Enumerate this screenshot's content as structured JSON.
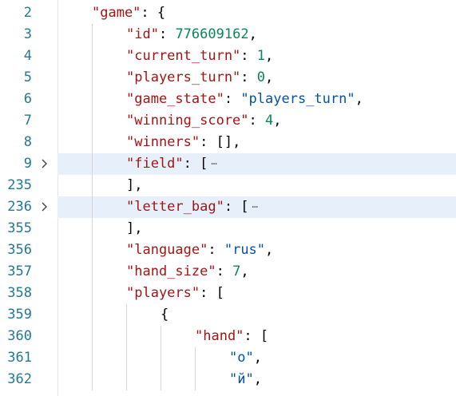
{
  "editor": {
    "lines": [
      {
        "num": "2",
        "indent": 0,
        "tokens": [
          {
            "t": "key",
            "v": "\"game\""
          },
          {
            "t": "pun",
            "v": ": {"
          }
        ]
      },
      {
        "num": "3",
        "indent": 1,
        "tokens": [
          {
            "t": "key",
            "v": "\"id\""
          },
          {
            "t": "pun",
            "v": ": "
          },
          {
            "t": "num",
            "v": "776609162"
          },
          {
            "t": "pun",
            "v": ","
          }
        ]
      },
      {
        "num": "4",
        "indent": 1,
        "tokens": [
          {
            "t": "key",
            "v": "\"current_turn\""
          },
          {
            "t": "pun",
            "v": ": "
          },
          {
            "t": "num",
            "v": "1"
          },
          {
            "t": "pun",
            "v": ","
          }
        ]
      },
      {
        "num": "5",
        "indent": 1,
        "tokens": [
          {
            "t": "key",
            "v": "\"players_turn\""
          },
          {
            "t": "pun",
            "v": ": "
          },
          {
            "t": "num",
            "v": "0"
          },
          {
            "t": "pun",
            "v": ","
          }
        ]
      },
      {
        "num": "6",
        "indent": 1,
        "tokens": [
          {
            "t": "key",
            "v": "\"game_state\""
          },
          {
            "t": "pun",
            "v": ": "
          },
          {
            "t": "str",
            "v": "\"players_turn\""
          },
          {
            "t": "pun",
            "v": ","
          }
        ]
      },
      {
        "num": "7",
        "indent": 1,
        "tokens": [
          {
            "t": "key",
            "v": "\"winning_score\""
          },
          {
            "t": "pun",
            "v": ": "
          },
          {
            "t": "num",
            "v": "4"
          },
          {
            "t": "pun",
            "v": ","
          }
        ]
      },
      {
        "num": "8",
        "indent": 1,
        "tokens": [
          {
            "t": "key",
            "v": "\"winners\""
          },
          {
            "t": "pun",
            "v": ": [],"
          }
        ]
      },
      {
        "num": "9",
        "indent": 1,
        "folded": true,
        "tokens": [
          {
            "t": "key",
            "v": "\"field\""
          },
          {
            "t": "pun",
            "v": ": ["
          }
        ],
        "ellipsis": "⋯"
      },
      {
        "num": "235",
        "indent": 1,
        "tokens": [
          {
            "t": "pun",
            "v": "],"
          }
        ]
      },
      {
        "num": "236",
        "indent": 1,
        "folded": true,
        "tokens": [
          {
            "t": "key",
            "v": "\"letter_bag\""
          },
          {
            "t": "pun",
            "v": ": ["
          }
        ],
        "ellipsis": "⋯"
      },
      {
        "num": "355",
        "indent": 1,
        "tokens": [
          {
            "t": "pun",
            "v": "],"
          }
        ]
      },
      {
        "num": "356",
        "indent": 1,
        "tokens": [
          {
            "t": "key",
            "v": "\"language\""
          },
          {
            "t": "pun",
            "v": ": "
          },
          {
            "t": "str",
            "v": "\"rus\""
          },
          {
            "t": "pun",
            "v": ","
          }
        ]
      },
      {
        "num": "357",
        "indent": 1,
        "tokens": [
          {
            "t": "key",
            "v": "\"hand_size\""
          },
          {
            "t": "pun",
            "v": ": "
          },
          {
            "t": "num",
            "v": "7"
          },
          {
            "t": "pun",
            "v": ","
          }
        ]
      },
      {
        "num": "358",
        "indent": 1,
        "tokens": [
          {
            "t": "key",
            "v": "\"players\""
          },
          {
            "t": "pun",
            "v": ": ["
          }
        ]
      },
      {
        "num": "359",
        "indent": 2,
        "tokens": [
          {
            "t": "pun",
            "v": "{"
          }
        ]
      },
      {
        "num": "360",
        "indent": 3,
        "tokens": [
          {
            "t": "key",
            "v": "\"hand\""
          },
          {
            "t": "pun",
            "v": ": ["
          }
        ]
      },
      {
        "num": "361",
        "indent": 4,
        "tokens": [
          {
            "t": "str",
            "v": "\"о\""
          },
          {
            "t": "pun",
            "v": ","
          }
        ]
      },
      {
        "num": "362",
        "indent": 4,
        "tokens": [
          {
            "t": "str",
            "v": "\"й\""
          },
          {
            "t": "pun",
            "v": ","
          }
        ]
      }
    ]
  },
  "colors": {
    "key": "#a31515",
    "string": "#0451a5",
    "number": "#098658",
    "line_number": "#237893",
    "highlight": "#e7f0fa"
  },
  "icons": {
    "fold": "chevron-right-icon"
  }
}
